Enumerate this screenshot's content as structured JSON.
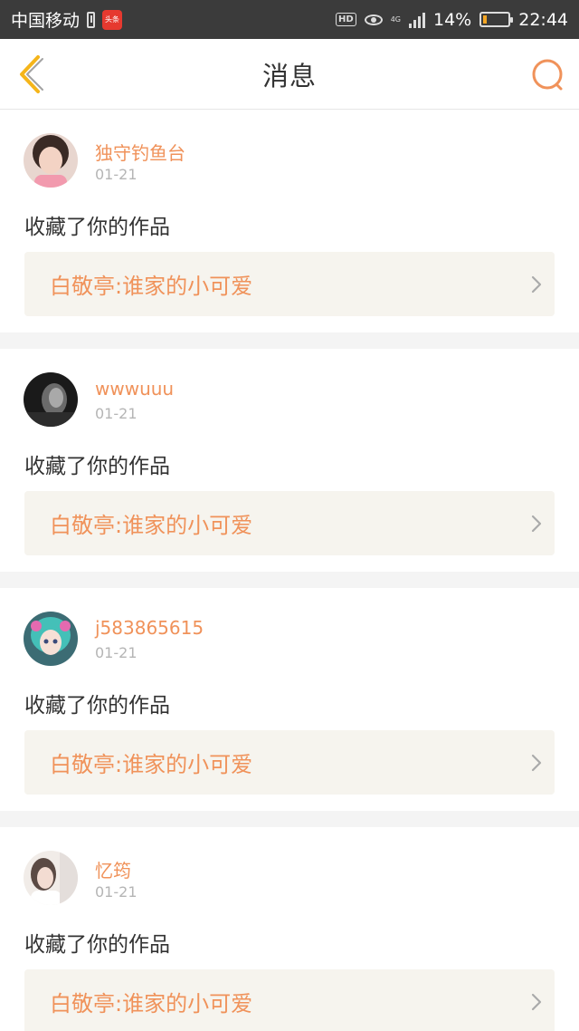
{
  "status_bar": {
    "carrier": "中国移动",
    "app_badge": "头条",
    "hd": "HD",
    "network": "4G",
    "battery": "14%",
    "battery_level": 0.14,
    "time": "22:44"
  },
  "nav": {
    "title": "消息",
    "accent_color": "#f0925a",
    "back_color": "#f5b51a"
  },
  "messages": [
    {
      "username": "独守钓鱼台",
      "date": "01-21",
      "action": "收藏了你的作品",
      "work_title": "白敬亭:谁家的小可爱"
    },
    {
      "username": "wwwuuu",
      "date": "01-21",
      "action": "收藏了你的作品",
      "work_title": "白敬亭:谁家的小可爱"
    },
    {
      "username": "j583865615",
      "date": "01-21",
      "action": "收藏了你的作品",
      "work_title": "白敬亭:谁家的小可爱"
    },
    {
      "username": "忆筠",
      "date": "01-21",
      "action": "收藏了你的作品",
      "work_title": "白敬亭:谁家的小可爱"
    }
  ]
}
